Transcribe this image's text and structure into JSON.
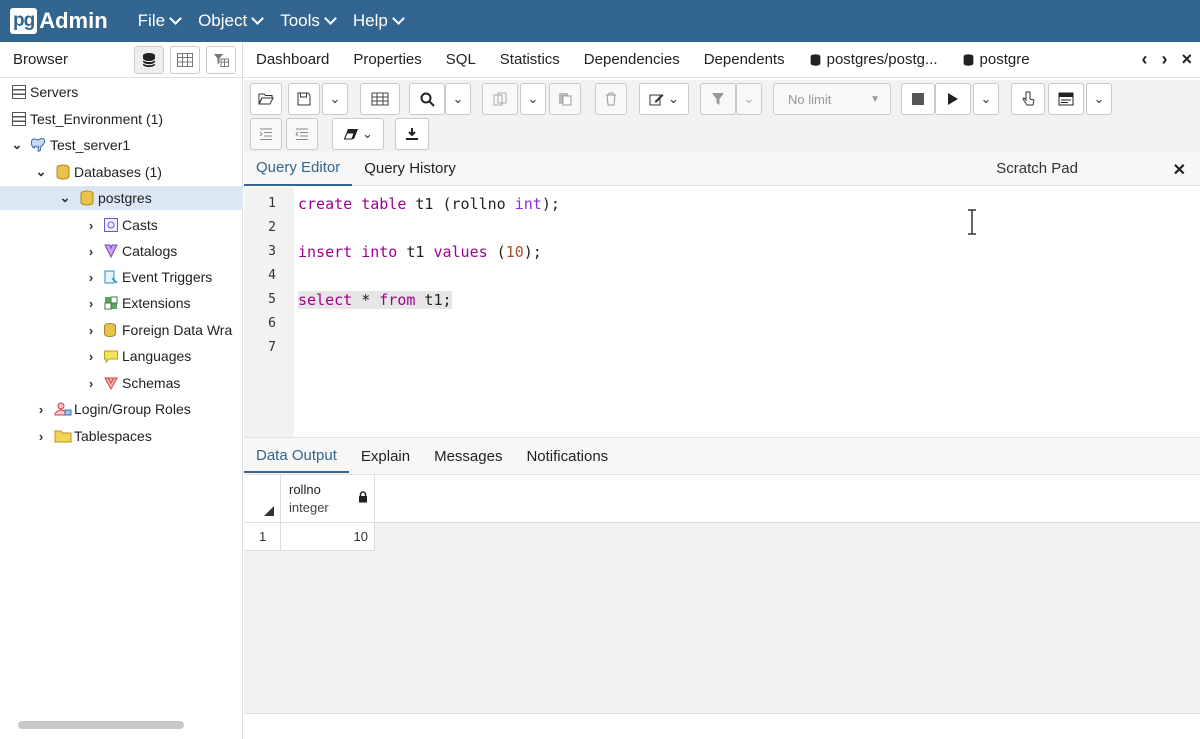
{
  "app": {
    "logo_pg": "pg",
    "logo_admin": "Admin"
  },
  "menu": {
    "items": [
      "File",
      "Object",
      "Tools",
      "Help"
    ]
  },
  "browser": {
    "title": "Browser",
    "tree": [
      {
        "label": "Servers"
      },
      {
        "label": "Test_Environment (1)"
      },
      {
        "label": "Test_server1"
      },
      {
        "label": "Databases (1)"
      },
      {
        "label": "postgres"
      },
      {
        "label": "Casts"
      },
      {
        "label": "Catalogs"
      },
      {
        "label": "Event Triggers"
      },
      {
        "label": "Extensions"
      },
      {
        "label": "Foreign Data Wra"
      },
      {
        "label": "Languages"
      },
      {
        "label": "Schemas"
      },
      {
        "label": "Login/Group Roles"
      },
      {
        "label": "Tablespaces"
      }
    ]
  },
  "tabs": {
    "items": [
      "Dashboard",
      "Properties",
      "SQL",
      "Statistics",
      "Dependencies",
      "Dependents",
      "postgres/postg...",
      "postgre"
    ]
  },
  "toolbar": {
    "limit_label": "No limit"
  },
  "editor_tabs": {
    "query_editor": "Query Editor",
    "query_history": "Query History",
    "scratch_pad": "Scratch Pad"
  },
  "editor": {
    "line_numbers": [
      "1",
      "2",
      "3",
      "4",
      "5",
      "6",
      "7"
    ],
    "lines": [
      {
        "kw1": "create",
        "kw2": "table",
        "rest": " t1 (rollno ",
        "type": "int",
        "end": ");"
      },
      {
        "kw1": "insert",
        "kw2": "into",
        "mid": " t1 ",
        "kw3": "values",
        "pre": " (",
        "num": "10",
        "end": ");"
      },
      {
        "kw1": "select",
        "mid": " * ",
        "kw2": "from",
        "end": " t1;"
      }
    ]
  },
  "output_tabs": {
    "data_output": "Data Output",
    "explain": "Explain",
    "messages": "Messages",
    "notifications": "Notifications"
  },
  "grid": {
    "columns": [
      {
        "name": "rollno",
        "type": "integer"
      }
    ],
    "rows": [
      {
        "num": "1",
        "values": [
          "10"
        ]
      }
    ]
  },
  "colors": {
    "navbar": "#326690",
    "accent": "#326690",
    "keyword": "#a0008c"
  }
}
